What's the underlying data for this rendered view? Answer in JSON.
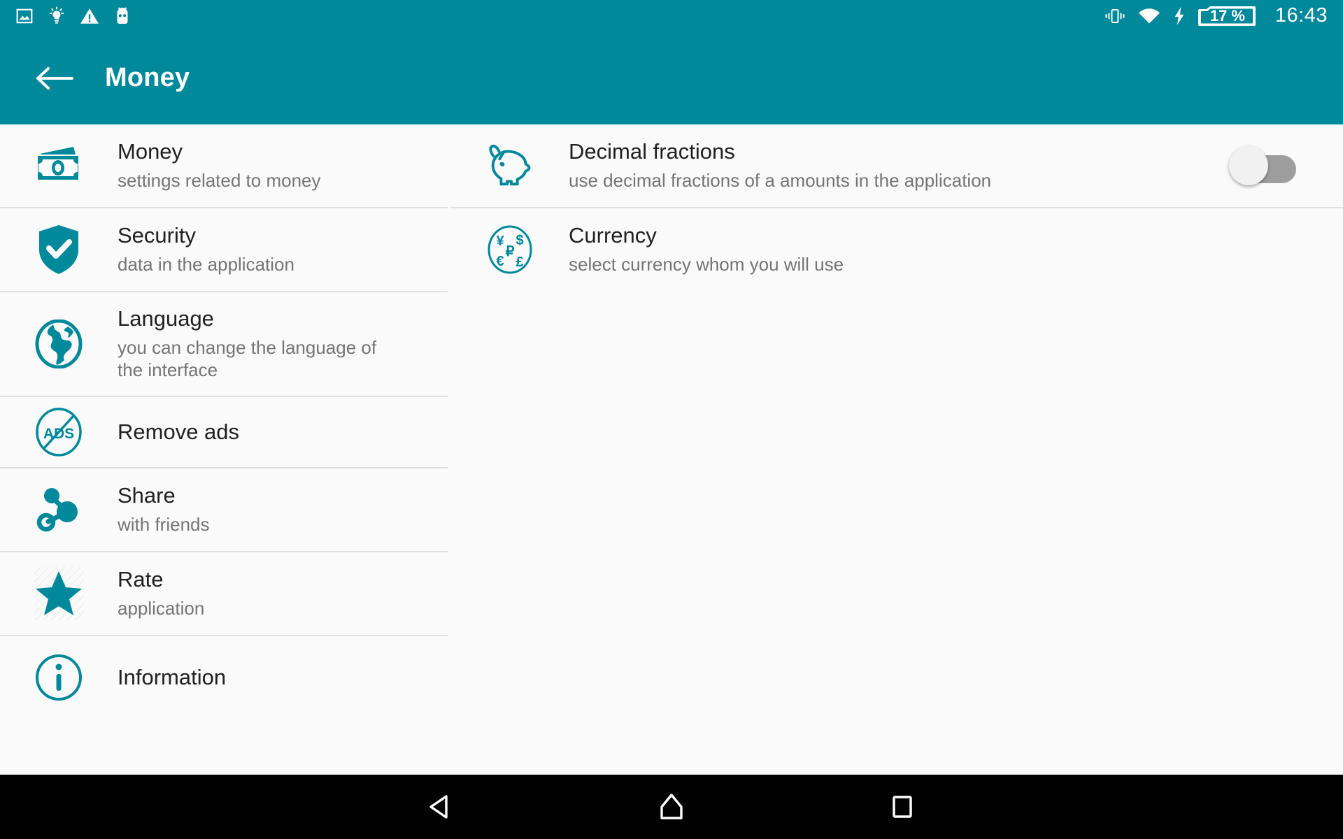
{
  "statusbar": {
    "left_icons": [
      "image-icon",
      "lightbulb-icon",
      "warning-triangle-icon",
      "cyanogenmod-robot-icon"
    ],
    "right_icons": [
      "vibrate-icon",
      "wifi-icon",
      "charging-bolt-icon",
      "battery-icon"
    ],
    "battery_level": "17 %",
    "time": "16:43"
  },
  "toolbar": {
    "back_icon": "back-arrow-icon",
    "title": "Money"
  },
  "colors": {
    "accent": "#00889B",
    "background": "#fafafa",
    "title_text": "#212121",
    "subtitle_text": "#757575",
    "divider": "#e0e0e0",
    "navbar": "#000000"
  },
  "left_list": {
    "items": [
      {
        "icon": "banknote-icon",
        "title": "Money",
        "subtitle": "settings related to money"
      },
      {
        "icon": "shield-check-icon",
        "title": "Security",
        "subtitle": "data in the application"
      },
      {
        "icon": "globe-icon",
        "title": "Language",
        "subtitle": "you can change the language of the interface"
      },
      {
        "icon": "no-ads-icon",
        "title": "Remove ads",
        "subtitle": ""
      },
      {
        "icon": "share-nodes-icon",
        "title": "Share",
        "subtitle": "with friends"
      },
      {
        "icon": "star-icon",
        "title": "Rate",
        "subtitle": "application"
      },
      {
        "icon": "info-circle-icon",
        "title": "Information",
        "subtitle": ""
      }
    ]
  },
  "right_list": {
    "items": [
      {
        "icon": "piggy-bank-icon",
        "title": "Decimal fractions",
        "subtitle": "use decimal fractions of a amounts in the application",
        "toggle": {
          "name": "decimal-fractions-toggle",
          "state": "off"
        }
      },
      {
        "icon": "currency-circle-icon",
        "title": "Currency",
        "subtitle": "select currency whom you will use",
        "currency_symbols": [
          "¥",
          "$",
          "₽",
          "€",
          "£"
        ]
      }
    ]
  },
  "navbar": {
    "buttons": [
      {
        "name": "nav-back-button",
        "icon": "triangle-back-icon"
      },
      {
        "name": "nav-home-button",
        "icon": "home-icon"
      },
      {
        "name": "nav-recents-button",
        "icon": "square-recents-icon"
      }
    ]
  }
}
